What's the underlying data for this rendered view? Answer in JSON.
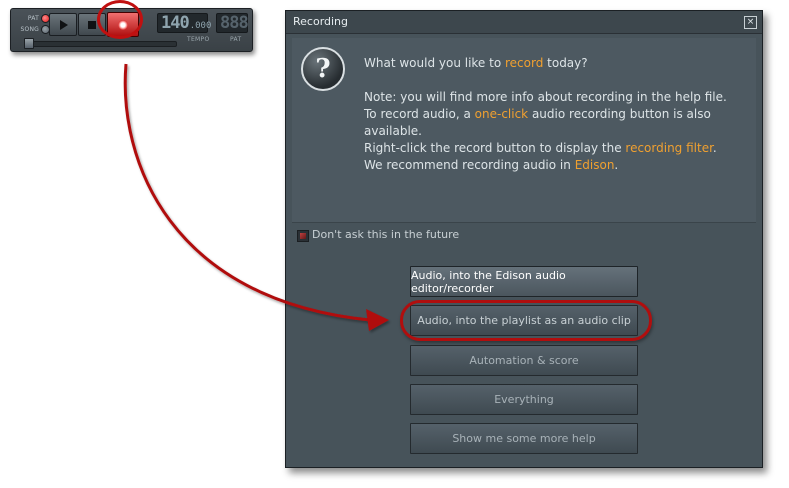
{
  "transport": {
    "pat_label": "PAT",
    "song_label": "SONG",
    "tempo_value": "140",
    "tempo_fraction": ".000",
    "tempo_label": "TEMPO",
    "pat_lcd_value": "888",
    "pat_lcd_label": "PAT",
    "icons": {
      "play": "play-icon",
      "stop": "stop-icon",
      "record": "record-icon"
    }
  },
  "dialog": {
    "title": "Recording",
    "close_label": "×",
    "help_icon_glyph": "?",
    "message": {
      "line1_pre": "What would you like to ",
      "line1_hl": "record",
      "line1_post": " today?",
      "note": "Note: you will find more info about recording in the help file.",
      "line3_pre": "To record audio, a ",
      "line3_hl": "one-click",
      "line3_post": " audio recording button is also",
      "line4": "available.",
      "line5_pre": "Right-click the record button to display the ",
      "line5_hl": "recording filter",
      "line5_post": ".",
      "line6_pre": "We recommend recording audio in ",
      "line6_hl": "Edison",
      "line6_post": "."
    },
    "dont_ask_label": "Don't ask this in the future",
    "options": [
      "Audio, into the Edison audio editor/recorder",
      "Audio, into the playlist as an audio clip",
      "Automation & score",
      "Everything",
      "Show me some more help"
    ]
  },
  "colors": {
    "accent": "#f0a030",
    "annotation_red": "#b00e0e",
    "dialog_bg": "#47535a"
  }
}
